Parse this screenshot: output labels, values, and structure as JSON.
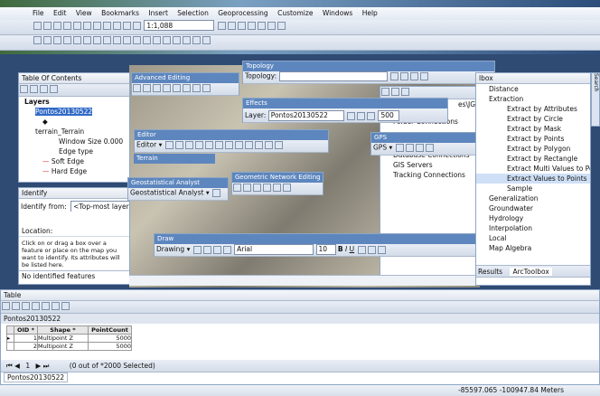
{
  "menu": [
    "File",
    "Edit",
    "View",
    "Bookmarks",
    "Insert",
    "Selection",
    "Geoprocessing",
    "Customize",
    "Windows",
    "Help"
  ],
  "scale": "1:1,088",
  "toc": {
    "title": "Table Of Contents",
    "items": [
      "Layers",
      "Pontos20130522",
      "terrain_Terrain",
      "Window Size 0.000",
      "Edge type",
      "Soft Edge",
      "Hard Edge"
    ]
  },
  "identify": {
    "title": "Identify",
    "from_label": "Identify from:",
    "from_value": "<Top-most layer>",
    "location": "Location:",
    "hint": "Click on or drag a box over a feature or place on the map you want to identify. Its attributes will be listed here.",
    "status": "No identified features"
  },
  "advanced_editing": "Advanced Editing",
  "editor": {
    "title": "Editor",
    "menu": "Editor ▾"
  },
  "terrain": "Terrain",
  "geostat": {
    "title": "Geostatistical Analyst",
    "menu": "Geostatistical Analyst ▾"
  },
  "geonet": "Geometric Network Editing",
  "topology": {
    "title": "Topology",
    "label": "Topology:"
  },
  "effects": {
    "title": "Effects",
    "layer_label": "Layer:",
    "layer_value": "Pontos20130522",
    "value": "500"
  },
  "gps": {
    "title": "GPS",
    "menu": "GPS ▾"
  },
  "catalog": {
    "items": [
      "Folder Connections",
      "Database Connections",
      "GIS Servers",
      "Tracking Connections"
    ],
    "side": "es\\JG"
  },
  "draw": {
    "title": "Draw",
    "menu": "Drawing ▾",
    "font": "Arial",
    "size": "10"
  },
  "toolbox": {
    "title": "lbox",
    "items": [
      "Distance",
      "Extraction",
      "Extract by Attributes",
      "Extract by Circle",
      "Extract by Mask",
      "Extract by Points",
      "Extract by Polygon",
      "Extract by Rectangle",
      "Extract Multi Values to Po",
      "Extract Values to Points",
      "Sample",
      "Generalization",
      "Groundwater",
      "Hydrology",
      "Interpolation",
      "Local",
      "Map Algebra"
    ],
    "tabs": [
      "Results",
      "ArcToolbox"
    ],
    "search": "Search"
  },
  "table": {
    "title": "Table",
    "layer": "Pontos20130522",
    "headers": [
      "OID *",
      "Shape *",
      "PointCount"
    ],
    "rows": [
      [
        "1",
        "Multipoint Z",
        "5000"
      ],
      [
        "2",
        "Multipoint Z",
        "5000"
      ]
    ],
    "record": "1",
    "selection": "(0 out of *2000 Selected)",
    "tab": "Pontos20130522"
  },
  "status": "-85597.065  -100947.84 Meters",
  "colors": {
    "accent": "#3169c6",
    "titlebar": "#5d86be"
  }
}
